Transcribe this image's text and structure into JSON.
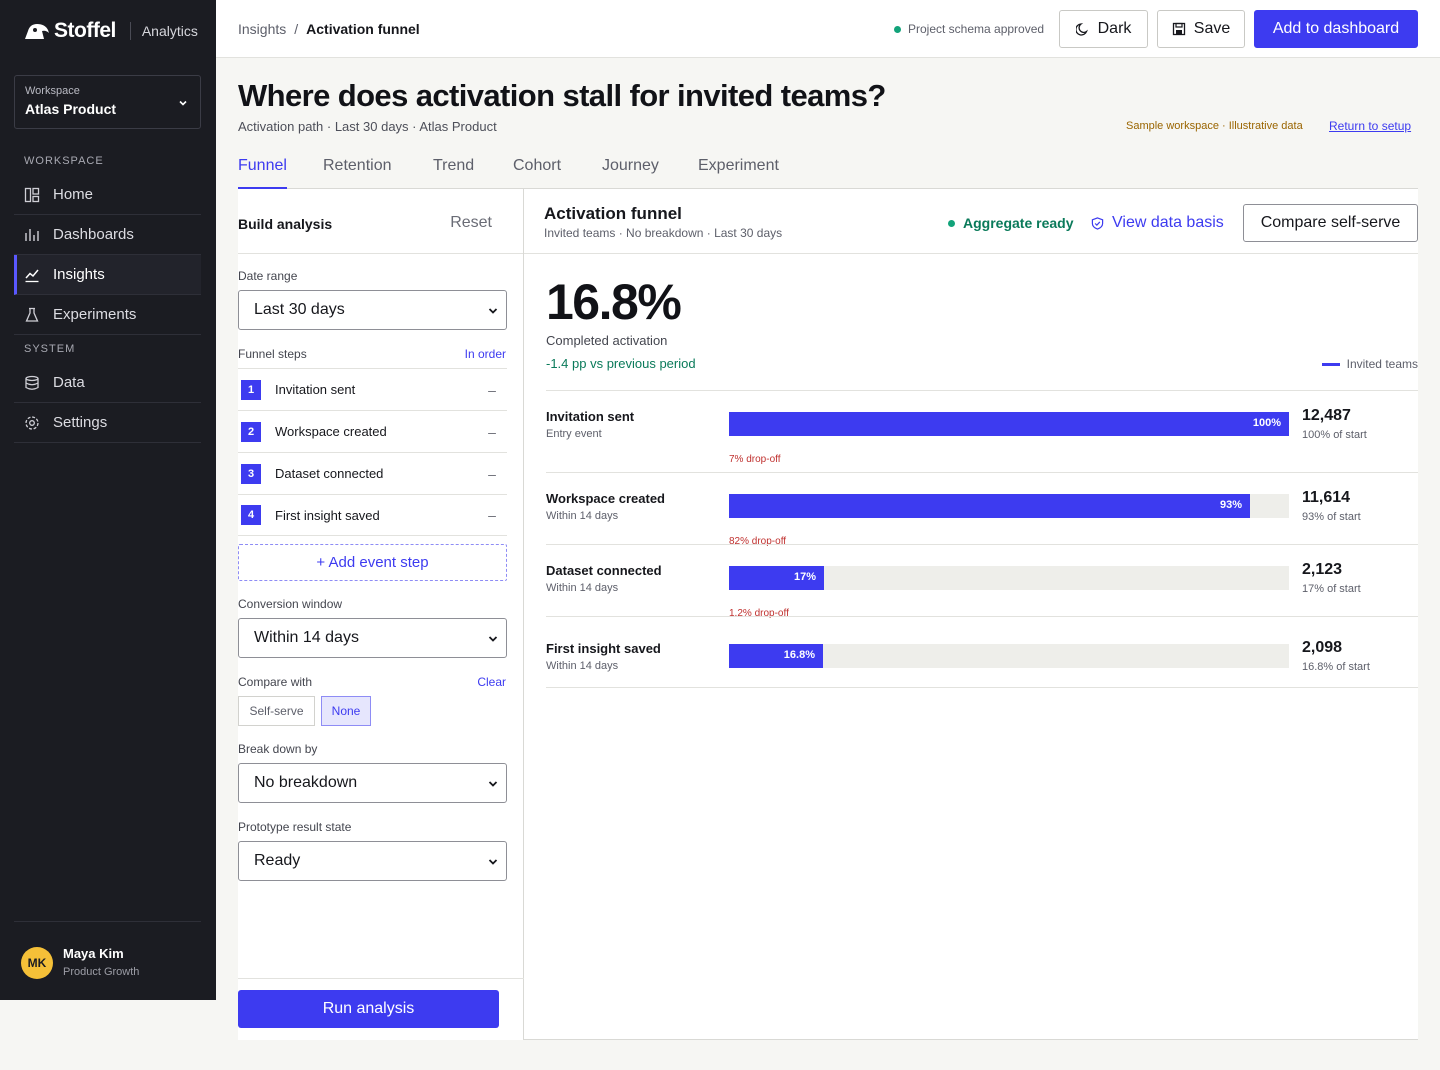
{
  "brand": {
    "name": "Stoffel",
    "product": "Analytics"
  },
  "workspace": {
    "label": "Workspace",
    "name": "Atlas Product"
  },
  "nav": {
    "section_workspace": "WORKSPACE",
    "section_system": "SYSTEM",
    "items": [
      {
        "label": "Home",
        "icon": "home-icon"
      },
      {
        "label": "Dashboards",
        "icon": "bar-chart-icon"
      },
      {
        "label": "Insights",
        "icon": "line-chart-icon",
        "active": true
      },
      {
        "label": "Experiments",
        "icon": "flask-icon"
      },
      {
        "label": "Data",
        "icon": "database-icon"
      },
      {
        "label": "Settings",
        "icon": "gear-icon"
      }
    ]
  },
  "user": {
    "initials": "MK",
    "name": "Maya Kim",
    "role": "Product Growth"
  },
  "topbar": {
    "breadcrumb_root": "Insights",
    "breadcrumb_sep": "/",
    "breadcrumb_current": "Activation funnel",
    "schema_status": "Project schema approved",
    "dark_label": "Dark",
    "save_label": "Save",
    "add_label": "Add to dashboard"
  },
  "header": {
    "title": "Where does activation stall for invited teams?",
    "subtitle": "Activation path · Last 30 days · Atlas Product",
    "sample_note": "Sample workspace · Illustrative data",
    "return_link": "Return to setup"
  },
  "tabs": [
    "Funnel",
    "Retention",
    "Trend",
    "Cohort",
    "Journey",
    "Experiment"
  ],
  "build": {
    "title": "Build analysis",
    "reset": "Reset",
    "date_range_label": "Date range",
    "date_range_value": "Last 30 days",
    "steps_label": "Funnel steps",
    "steps_order": "In order",
    "steps": [
      {
        "num": "1",
        "name": "Invitation sent"
      },
      {
        "num": "2",
        "name": "Workspace created"
      },
      {
        "num": "3",
        "name": "Dataset connected"
      },
      {
        "num": "4",
        "name": "First insight saved"
      }
    ],
    "step_remove": "–",
    "add_step": "+ Add event step",
    "window_label": "Conversion window",
    "window_value": "Within 14 days",
    "compare_label": "Compare with",
    "compare_clear": "Clear",
    "compare_options": [
      "Self-serve",
      "None"
    ],
    "breakdown_label": "Break down by",
    "breakdown_value": "No breakdown",
    "state_label": "Prototype result state",
    "state_value": "Ready",
    "run": "Run analysis"
  },
  "results": {
    "title": "Activation funnel",
    "subtitle": "Invited teams · No breakdown · Last 30 days",
    "aggregate": "Aggregate ready",
    "basis": "View data basis",
    "compare": "Compare self-serve",
    "kpi_value": "16.8%",
    "kpi_label": "Completed activation",
    "kpi_delta": "-1.4 pp vs previous period",
    "legend": "Invited teams"
  },
  "chart_data": {
    "type": "bar",
    "orientation": "horizontal",
    "series": [
      {
        "name": "Invited teams",
        "values": [
          100,
          93,
          17,
          16.8
        ]
      }
    ],
    "categories": [
      "Invitation sent",
      "Workspace created",
      "Dataset connected",
      "First insight saved"
    ],
    "rows": [
      {
        "name": "Invitation sent",
        "sub": "Entry event",
        "pct": 100,
        "pct_label": "100%",
        "count": "12,487",
        "of_start": "100% of start",
        "drop": "7% drop-off"
      },
      {
        "name": "Workspace created",
        "sub": "Within 14 days",
        "pct": 93,
        "pct_label": "93%",
        "count": "11,614",
        "of_start": "93% of start",
        "drop": "82% drop-off"
      },
      {
        "name": "Dataset connected",
        "sub": "Within 14 days",
        "pct": 17,
        "pct_label": "17%",
        "count": "2,123",
        "of_start": "17% of start",
        "drop": "1.2% drop-off"
      },
      {
        "name": "First insight saved",
        "sub": "Within 14 days",
        "pct": 16.8,
        "pct_label": "16.8%",
        "count": "2,098",
        "of_start": "16.8% of start",
        "drop": ""
      }
    ],
    "xlim": [
      0,
      100
    ],
    "colors": {
      "fill": "#3d3bf0",
      "track": "#eeeeea",
      "drop": "#c0312f"
    }
  }
}
